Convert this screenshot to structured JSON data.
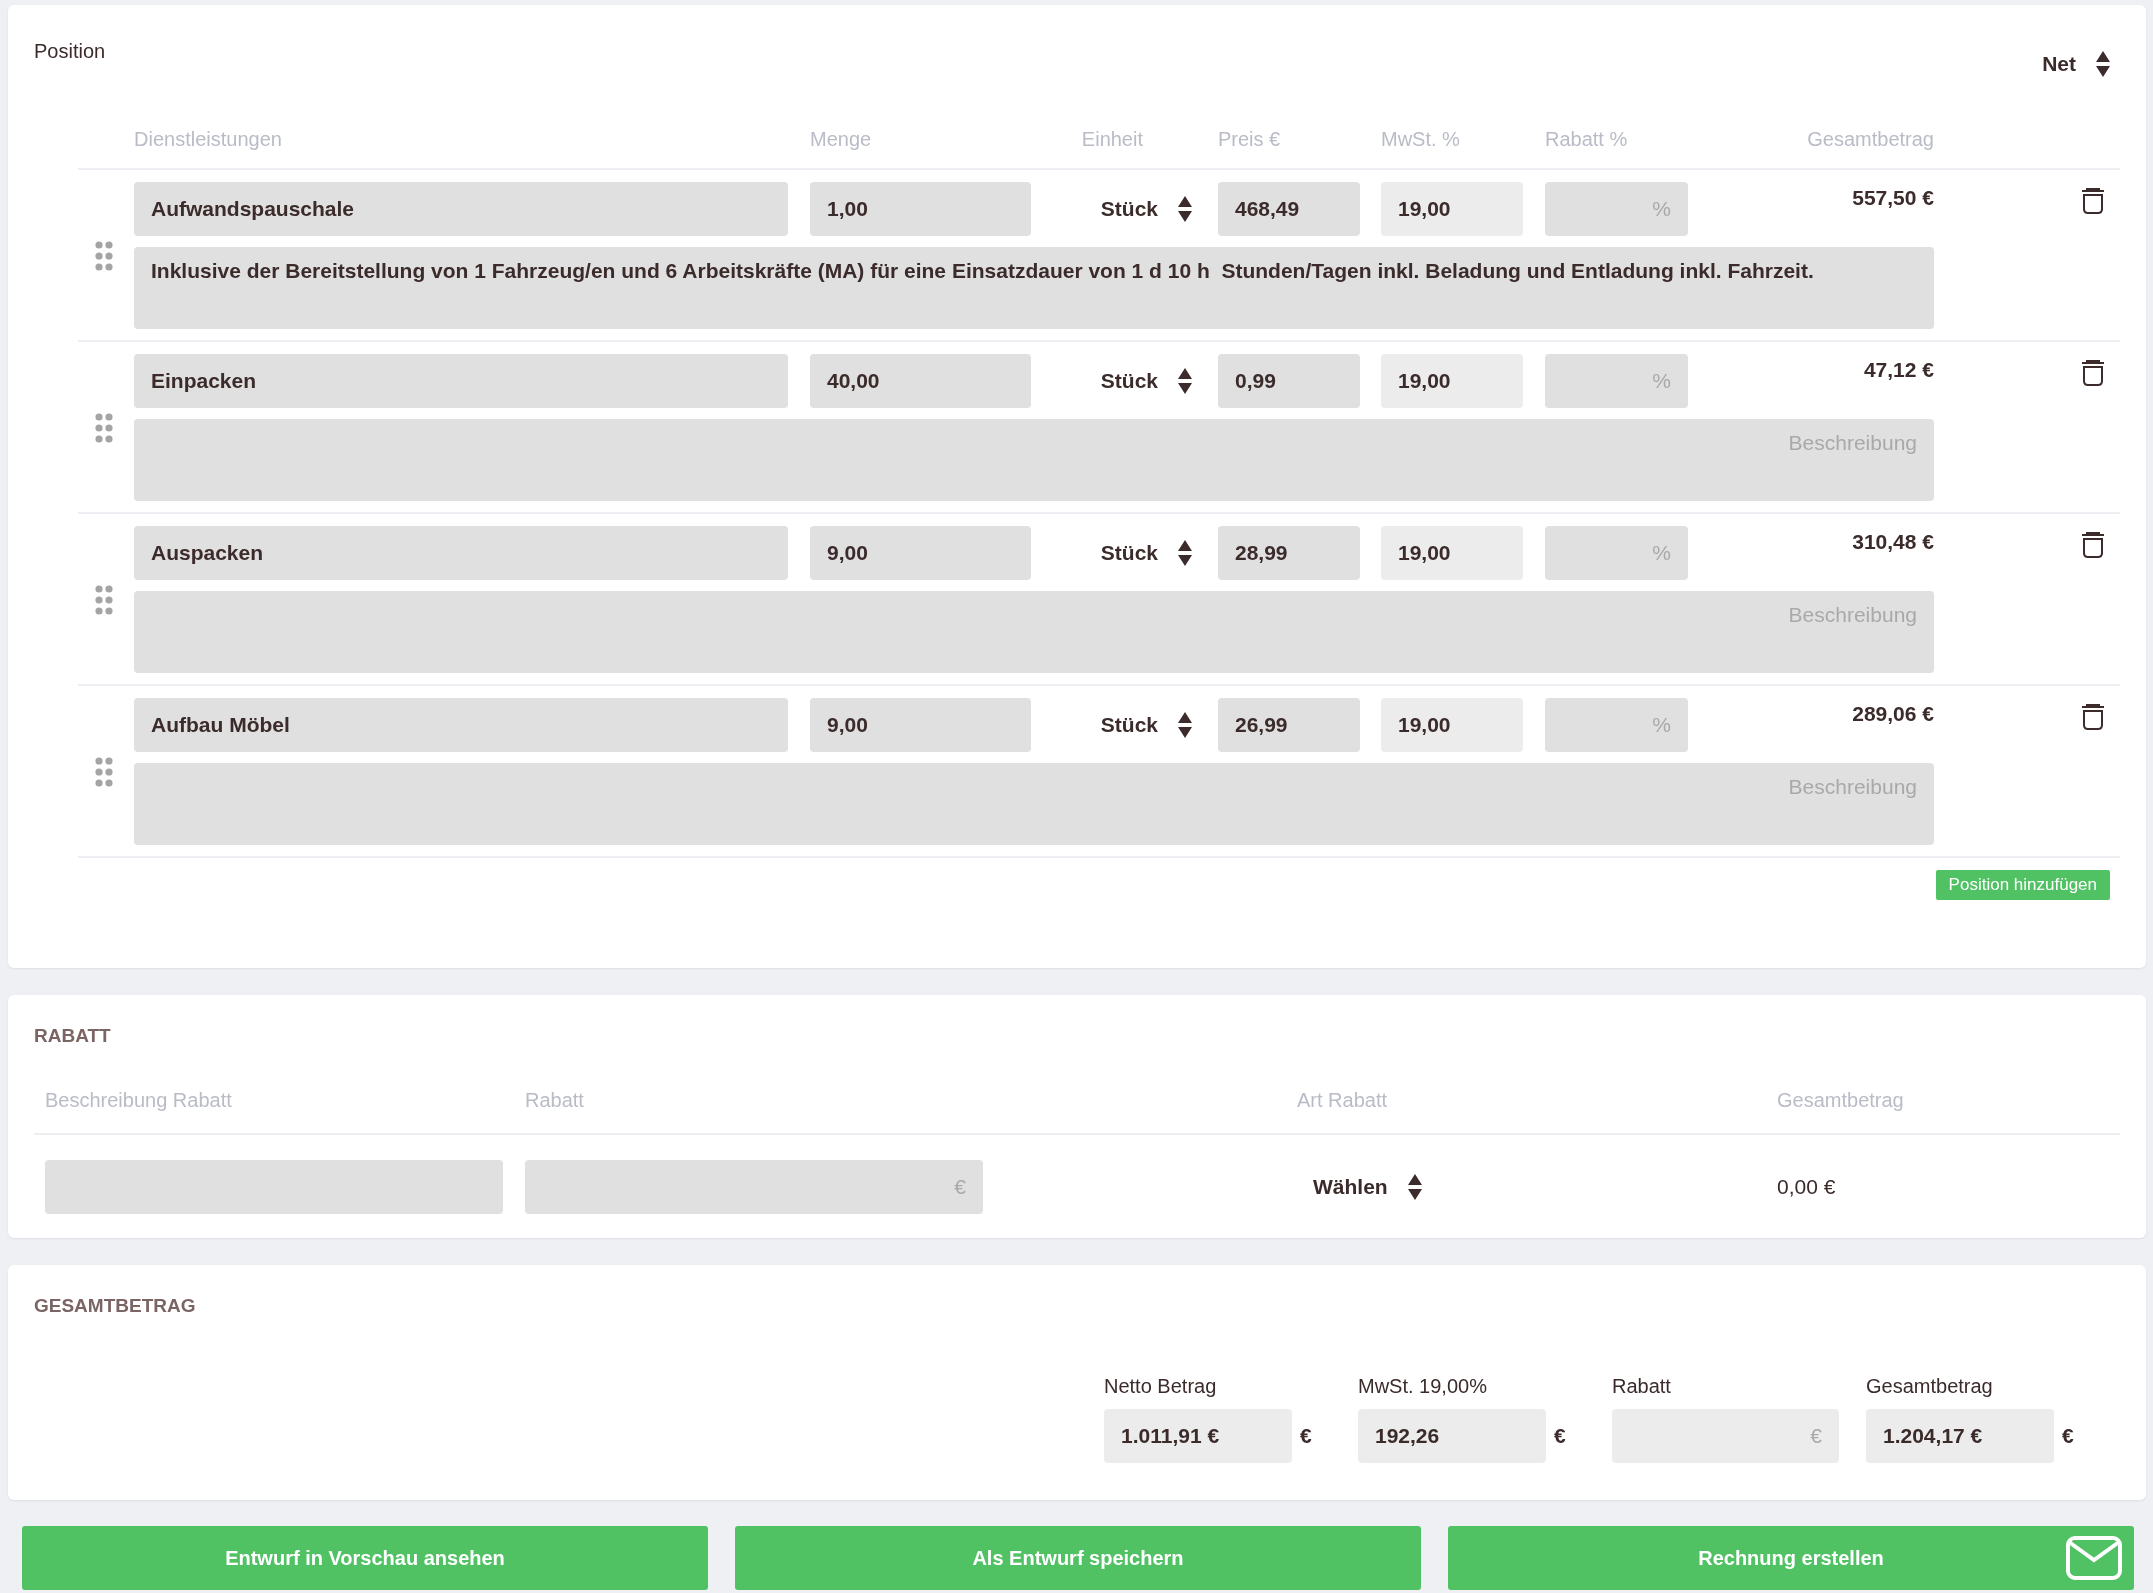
{
  "position_card": {
    "title": "Position",
    "price_mode": "Net",
    "columns": [
      "Dienstleistungen",
      "Menge",
      "Einheit",
      "Preis €",
      "MwSt. %",
      "Rabatt %",
      "Gesamtbetrag"
    ],
    "rows": [
      {
        "name": "Aufwandspauschale",
        "quantity": "1,00",
        "unit": "Stück",
        "price": "468,49",
        "vat": "19,00",
        "discount_placeholder": "%",
        "total": "557,50 €",
        "description": "Inklusive der Bereitstellung von 1 Fahrzeug/en und 6 Arbeitskräfte (MA) für eine Einsatzdauer von 1 d 10 h  Stunden/Tagen inkl. Beladung und Entladung inkl. Fahrzeit."
      },
      {
        "name": "Einpacken",
        "quantity": "40,00",
        "unit": "Stück",
        "price": "0,99",
        "vat": "19,00",
        "discount_placeholder": "%",
        "total": "47,12 €",
        "description_placeholder": "Beschreibung"
      },
      {
        "name": "Auspacken",
        "quantity": "9,00",
        "unit": "Stück",
        "price": "28,99",
        "vat": "19,00",
        "discount_placeholder": "%",
        "total": "310,48 €",
        "description_placeholder": "Beschreibung"
      },
      {
        "name": "Aufbau Möbel",
        "quantity": "9,00",
        "unit": "Stück",
        "price": "26,99",
        "vat": "19,00",
        "discount_placeholder": "%",
        "total": "289,06 €",
        "description_placeholder": "Beschreibung"
      }
    ],
    "add_button": "Position hinzufügen"
  },
  "discount_card": {
    "title": "RABATT",
    "columns": [
      "Beschreibung Rabatt",
      "Rabatt",
      "Art Rabatt",
      "Gesamtbetrag"
    ],
    "amount_placeholder": "€",
    "type": "Wählen",
    "total": "0,00 €"
  },
  "totals_card": {
    "title": "GESAMTBETRAG",
    "fields": [
      {
        "label": "Netto Betrag",
        "value": "1.011,91 €",
        "suffix": "€"
      },
      {
        "label": "MwSt. 19,00%",
        "value": "192,26",
        "suffix": "€"
      },
      {
        "label": "Rabatt",
        "placeholder": "€"
      },
      {
        "label": "Gesamtbetrag",
        "value": "1.204,17 €",
        "suffix": "€"
      }
    ]
  },
  "actions": [
    {
      "label": "Entwurf in Vorschau ansehen",
      "kind": "plain"
    },
    {
      "label": "Als Entwurf speichern",
      "kind": "plain"
    },
    {
      "label": "Rechnung erstellen",
      "kind": "send"
    }
  ]
}
